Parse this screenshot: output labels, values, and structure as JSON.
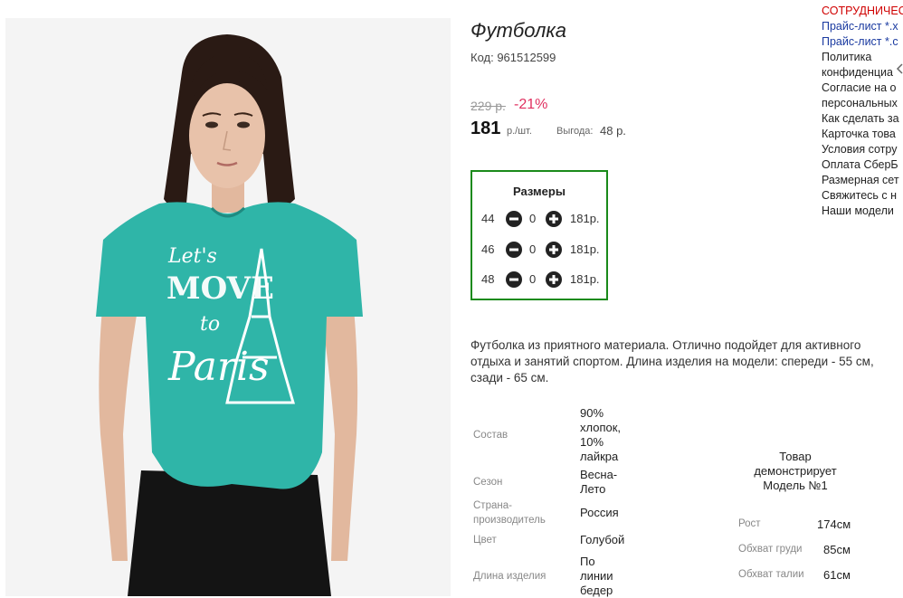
{
  "product": {
    "title": "Футболка",
    "code": "Код: 961512599",
    "old_price": "229 р.",
    "discount": "-21%",
    "price": "181",
    "unit": "р./шт.",
    "savings_label": "Выгода:",
    "savings_value": "48 р."
  },
  "sizes": {
    "title": "Размеры",
    "rows": [
      {
        "size": "44",
        "qty": "0",
        "price": "181р."
      },
      {
        "size": "46",
        "qty": "0",
        "price": "181р."
      },
      {
        "size": "48",
        "qty": "0",
        "price": "181р."
      }
    ]
  },
  "description": "Футболка из приятного материала. Отлично подойдет для активного отдыха и занятий спортом. Длина изделия на модели: спереди - 55 см, сзади - 65 см.",
  "specs": [
    {
      "label": "Состав",
      "value": "90% хлопок, 10% лайкра"
    },
    {
      "label": "Сезон",
      "value": "Весна-Лето"
    },
    {
      "label": "Страна-производитель",
      "value": "Россия"
    },
    {
      "label": "Цвет",
      "value": "Голубой"
    },
    {
      "label": "Длина изделия",
      "value": "По линии бедер"
    }
  ],
  "model": {
    "title": "Товар демонстрирует Модель №1",
    "params": [
      {
        "label": "Рост",
        "value": "174см"
      },
      {
        "label": "Обхват груди",
        "value": "85см"
      },
      {
        "label": "Обхват талии",
        "value": "61см"
      }
    ]
  },
  "side_menu": [
    {
      "label": "СОТРУДНИЧЕС",
      "style": "red"
    },
    {
      "label": "Прайс-лист *.x",
      "style": "blue"
    },
    {
      "label": "Прайс-лист *.c",
      "style": "blue"
    },
    {
      "label": "Политика",
      "style": "dark"
    },
    {
      "label": "конфиденциа",
      "style": "dark"
    },
    {
      "label": "Согласие на о",
      "style": "dark"
    },
    {
      "label": "персональных",
      "style": "dark"
    },
    {
      "label": "Как сделать за",
      "style": "dark"
    },
    {
      "label": "Карточка това",
      "style": "dark"
    },
    {
      "label": "Условия сотру",
      "style": "dark"
    },
    {
      "label": "Оплата СберБ",
      "style": "dark"
    },
    {
      "label": "Размерная сет",
      "style": "dark"
    },
    {
      "label": "Свяжитесь с н",
      "style": "dark"
    },
    {
      "label": "Наши модели",
      "style": "dark"
    }
  ],
  "photo": {
    "shirt_print_line1": "Let's",
    "shirt_print_line2": "MOVE",
    "shirt_print_line3": "to",
    "shirt_print_line4": "Paris",
    "colors": {
      "shirt": "#2fb5a8",
      "pants": "#141414",
      "hair": "#2a1a14",
      "skin": "#e8c2aa",
      "background": "#f4f4f4"
    }
  },
  "colors": {
    "frame_border": "#1a8a1a",
    "discount": "#e03060",
    "side_red": "#d00000",
    "side_blue": "#1a3aa0"
  }
}
